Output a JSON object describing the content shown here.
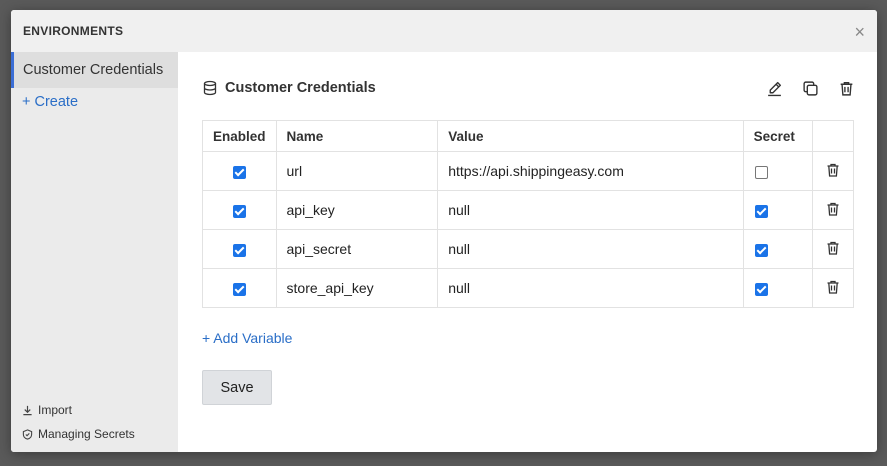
{
  "modal": {
    "title": "ENVIRONMENTS",
    "close_label": "×"
  },
  "sidebar": {
    "items": [
      {
        "label": "Customer Credentials",
        "active": true
      }
    ],
    "create_label": "+ Create",
    "footer": {
      "import_label": "Import",
      "managing_secrets_label": "Managing Secrets"
    }
  },
  "environment": {
    "title": "Customer Credentials",
    "actions": [
      "edit-icon",
      "copy-icon",
      "trash-icon"
    ]
  },
  "table": {
    "headers": {
      "enabled": "Enabled",
      "name": "Name",
      "value": "Value",
      "secret": "Secret"
    },
    "rows": [
      {
        "enabled": true,
        "name": "url",
        "value": "https://api.shippingeasy.com",
        "secret": false
      },
      {
        "enabled": true,
        "name": "api_key",
        "value": "null",
        "secret": true
      },
      {
        "enabled": true,
        "name": "api_secret",
        "value": "null",
        "secret": true
      },
      {
        "enabled": true,
        "name": "store_api_key",
        "value": "null",
        "secret": true
      }
    ]
  },
  "add_variable_label": "+ Add Variable",
  "save_label": "Save",
  "colors": {
    "accent": "#1a73e8",
    "link": "#2a6ec7",
    "overlay": "#5a5a5a"
  }
}
